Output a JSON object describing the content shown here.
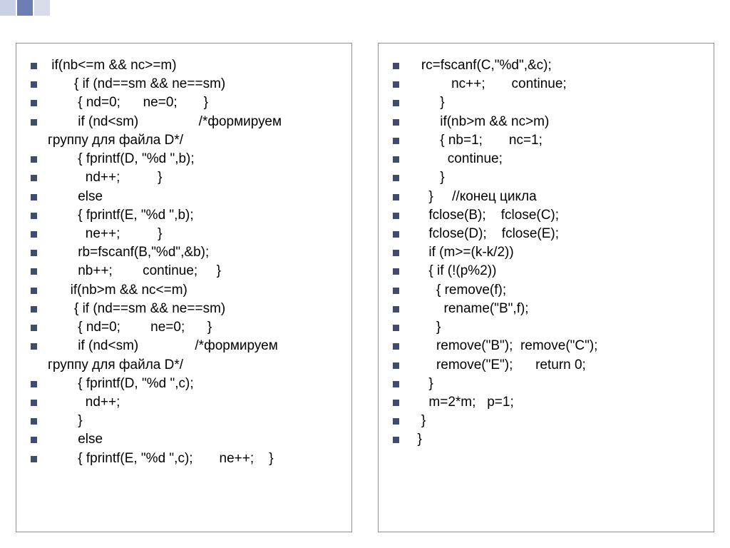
{
  "left": {
    "lines": [
      " if(nb<=m && nc>=m)",
      "       { if (nd==sm && ne==sm)",
      "        { nd=0;      ne=0;       }",
      "        if (nd<sm)                /*формируем группу для файла D*/",
      "        { fprintf(D, \"%d \",b);",
      "          nd++;          }",
      "        else",
      "        { fprintf(E, \"%d \",b);",
      "          ne++;          }",
      "        rb=fscanf(B,\"%d\",&b);",
      "        nb++;        continue;     }",
      "      if(nb>m && nc<=m)",
      "       { if (nd==sm && ne==sm)",
      "        { nd=0;        ne=0;      }",
      "        if (nd<sm)               /*формируем группу для файла D*/",
      "        { fprintf(D, \"%d \",c);",
      "          nd++;",
      "        }",
      "        else",
      "        { fprintf(E, \"%d \",c);       ne++;    }"
    ]
  },
  "right": {
    "lines": [
      "   rc=fscanf(C,\"%d\",&c);",
      "           nc++;       continue;",
      "        }",
      "        if(nb>m && nc>m)",
      "        { nb=1;       nc=1;",
      "          continue;",
      "        }",
      "     }     //конец цикла",
      "     fclose(B);    fclose(C);",
      "     fclose(D);    fclose(E);",
      "     if (m>=(k-k/2))",
      "     { if (!(p%2))",
      "       { remove(f);",
      "         rename(\"B\",f);",
      "       }",
      "       remove(\"B\");  remove(\"C\");",
      "       remove(\"E\");      return 0;",
      "     }",
      "     m=2*m;   p=1;",
      "   }",
      "  }"
    ]
  }
}
